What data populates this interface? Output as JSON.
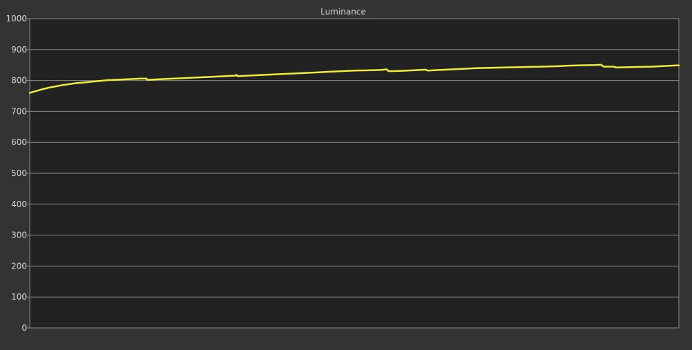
{
  "chart_data": {
    "type": "line",
    "title": "Luminance",
    "xlabel": "",
    "ylabel": "",
    "ylim": [
      0,
      1000
    ],
    "y_ticks": [
      0,
      100,
      200,
      300,
      400,
      500,
      600,
      700,
      800,
      900,
      1000
    ],
    "xlim": [
      0,
      100
    ],
    "grid": true,
    "legend": "none",
    "colors": {
      "background": "#333333",
      "plot_area": "#222222",
      "grid": "#8a8a8a",
      "line": "#f2ec3a",
      "text": "#d6d6d6"
    },
    "series": [
      {
        "x": [
          0,
          1,
          2,
          3,
          4,
          5,
          6,
          7,
          8,
          9,
          10,
          11,
          12,
          13,
          14,
          15,
          16,
          17,
          18,
          18.1,
          20,
          22,
          24,
          26,
          28,
          30,
          32,
          31.8,
          32.1,
          34,
          36,
          38,
          40,
          42,
          44,
          46,
          48,
          50,
          52,
          54,
          55,
          55.3,
          57,
          59,
          61,
          61.3,
          63,
          65,
          67,
          69,
          71,
          73,
          75,
          77,
          79,
          81,
          83,
          85,
          87,
          88,
          88.4,
          89,
          90,
          90.3,
          92,
          94,
          96,
          98,
          100
        ],
        "y": [
          760,
          766,
          772,
          777,
          781,
          785,
          788,
          791,
          793,
          795,
          797,
          799,
          801,
          802,
          803,
          804,
          805,
          806,
          806,
          802,
          804,
          806,
          808,
          810,
          812,
          814,
          816,
          818,
          814,
          816,
          818,
          820,
          822,
          824,
          826,
          828,
          830,
          832,
          833,
          834,
          836,
          830,
          831,
          833,
          835,
          832,
          834,
          836,
          838,
          840,
          841,
          842,
          843,
          844,
          845,
          846,
          848,
          849,
          850,
          851,
          845,
          845,
          845,
          842,
          843,
          844,
          845,
          847,
          849
        ]
      }
    ]
  }
}
